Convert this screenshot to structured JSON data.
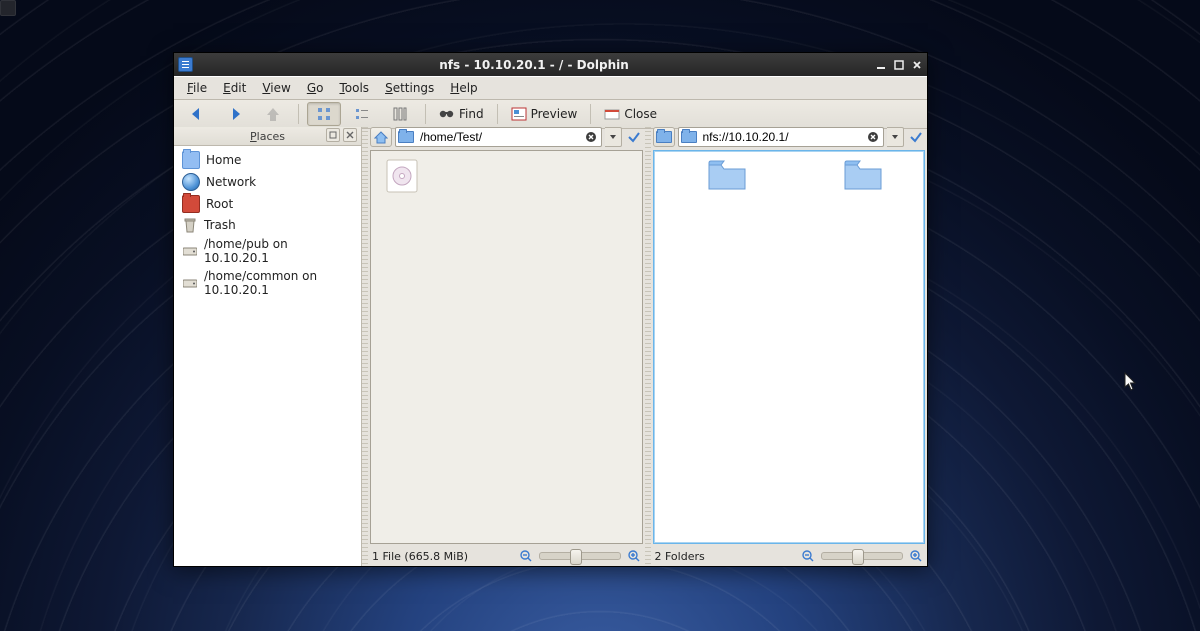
{
  "window": {
    "title": "nfs - 10.10.20.1 - / - Dolphin"
  },
  "menu": {
    "file": "File",
    "edit": "Edit",
    "view": "View",
    "go": "Go",
    "tools": "Tools",
    "settings": "Settings",
    "help": "Help"
  },
  "toolbar": {
    "find": "Find",
    "preview": "Preview",
    "close": "Close"
  },
  "sidebar": {
    "header": "Places",
    "items": [
      {
        "icon": "folder",
        "label": "Home"
      },
      {
        "icon": "globe",
        "label": "Network"
      },
      {
        "icon": "root",
        "label": "Root"
      },
      {
        "icon": "trash",
        "label": "Trash"
      },
      {
        "icon": "mount",
        "label": "/home/pub on 10.10.20.1"
      },
      {
        "icon": "mount",
        "label": "/home/common on 10.10.20.1"
      }
    ]
  },
  "panes": {
    "left": {
      "path": "/home/Test/",
      "status": "1 File (665.8 MiB)"
    },
    "right": {
      "path": "nfs://10.10.20.1/",
      "status": "2 Folders"
    }
  }
}
